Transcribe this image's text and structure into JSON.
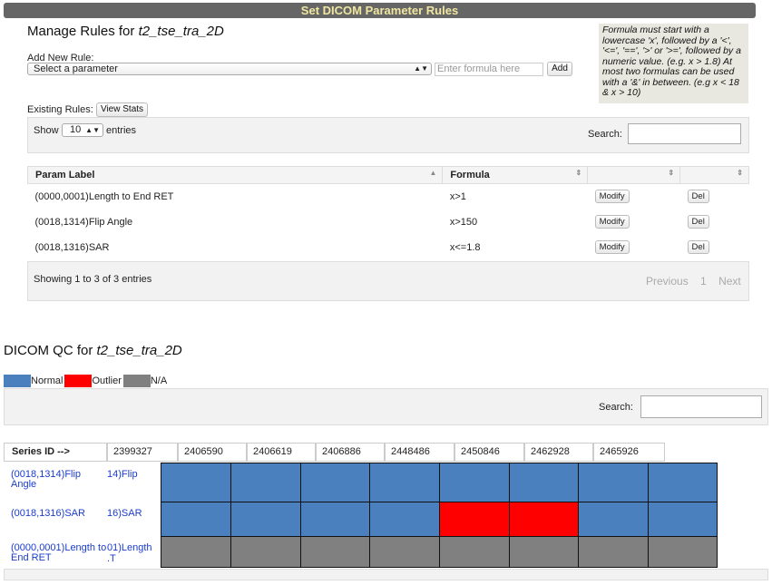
{
  "header": {
    "title": "Set DICOM Parameter Rules"
  },
  "manage": {
    "title_prefix": "Manage Rules for ",
    "series_name": "t2_tse_tra_2D",
    "add_rule_label": "Add New Rule:",
    "select_value": "Select a parameter",
    "formula_placeholder": "Enter formula here",
    "add_button": "Add",
    "help_text": "Formula must start with a lowercase 'x', followed by a '<', '<=', '==', '>' or '>=', followed by a numeric value. (e.g. x > 1.8) At most two formulas can be used with a '&' in between. (e.g x < 18 & x > 10)",
    "existing_label": "Existing Rules:",
    "view_stats_button": "View Stats",
    "show_label": "Show",
    "show_value": "10",
    "entries_label": "entries",
    "search_label": "Search:",
    "columns": [
      "Param Label",
      "Formula",
      "",
      ""
    ],
    "rows": [
      {
        "label": "(0000,0001)Length to End RET",
        "formula": "x>1",
        "modify": "Modify",
        "del": "Del"
      },
      {
        "label": "(0018,1314)Flip Angle",
        "formula": "x>150",
        "modify": "Modify",
        "del": "Del"
      },
      {
        "label": "(0018,1316)SAR",
        "formula": "x<=1.8",
        "modify": "Modify",
        "del": "Del"
      }
    ],
    "showing_text": "Showing 1 to 3 of 3 entries",
    "pager": {
      "previous": "Previous",
      "page": "1",
      "next": "Next"
    }
  },
  "qc": {
    "title_prefix": "DICOM QC for ",
    "series_name": "t2_tse_tra_2D",
    "legend": [
      {
        "label": "Normal",
        "color": "#4a80bd"
      },
      {
        "label": "Outlier",
        "color": "#ff0000"
      },
      {
        "label": "N/A",
        "color": "#808080"
      }
    ],
    "search_label": "Search:",
    "series_header": "Series ID -->",
    "series_ids": [
      "2399327",
      "2406590",
      "2406619",
      "2406886",
      "2448486",
      "2450846",
      "2462928",
      "2465926"
    ],
    "rows": [
      {
        "label": "(0018,1314)Flip Angle",
        "behind": "14)Flip",
        "states": [
          "normal",
          "normal",
          "normal",
          "normal",
          "normal",
          "normal",
          "normal",
          "normal"
        ]
      },
      {
        "label": "(0018,1316)SAR",
        "behind": "16)SAR",
        "states": [
          "normal",
          "normal",
          "normal",
          "normal",
          "outlier",
          "outlier",
          "normal",
          "normal"
        ]
      },
      {
        "label": "(0000,0001)Length to End RET",
        "behind": "01)Length",
        "behind2": ".T",
        "states": [
          "na",
          "na",
          "na",
          "na",
          "na",
          "na",
          "na",
          "na"
        ]
      }
    ]
  }
}
